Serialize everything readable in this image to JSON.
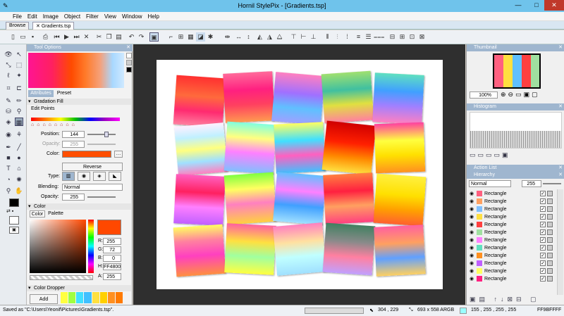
{
  "window": {
    "title": "Hornil StylePix - [Gradients.tsp]",
    "min": "—",
    "max": "□",
    "close": "✕"
  },
  "menu": [
    "File",
    "Edit",
    "Image",
    "Object",
    "Filter",
    "View",
    "Window",
    "Help"
  ],
  "tabs": {
    "browse": "Browse",
    "doc": "Gradients.tsp"
  },
  "tool_options": {
    "title": "Tool Options",
    "tab_attributes": "Attributes",
    "tab_preset": "Preset",
    "gradation_fill": "Gradation Fill",
    "edit_points": "Edit Points",
    "position_label": "Position:",
    "position_value": "144",
    "opacity_label": "Opacity:",
    "opacity_value": "255",
    "color_label": "Color:",
    "color_value": "#ff4e00",
    "reverse": "Reverse",
    "type_label": "Type:",
    "blending_label": "Blending:",
    "blending_value": "Normal",
    "opacity2_label": "Opacity:",
    "opacity2_value": "255"
  },
  "color_panel": {
    "title": "Color",
    "tab_color": "Color",
    "tab_palette": "Palette",
    "r_label": "R:",
    "r": "255",
    "g_label": "G:",
    "g": "72",
    "b_label": "B:",
    "b": "0",
    "h_label": "H:",
    "hex": "FF4800",
    "a_label": "A:",
    "a": "255"
  },
  "color_dropper": {
    "title": "Color Dropper",
    "add": "Add"
  },
  "right": {
    "thumbnail": "Thumbnail",
    "zoom": "100%",
    "histogram": "Histogram",
    "action_list": "Action List",
    "hierarchy": "Hierarchy",
    "blend": "Normal",
    "opacity": "255",
    "layers": [
      "Rectangle",
      "Rectangle",
      "Rectangle",
      "Rectangle",
      "Rectangle",
      "Rectangle",
      "Rectangle",
      "Rectangle",
      "Rectangle",
      "Rectangle",
      "Rectangle",
      "Rectangle"
    ]
  },
  "status": {
    "saved": "Saved as \"C:\\Users\\Yeonif\\Pictures\\Gradients.tsp\".",
    "coords": "304  , 229",
    "size": "693 x 558 ARGB",
    "rgba": "155  , 255  , 255  , 255",
    "hex": "FF9BFFFF"
  }
}
